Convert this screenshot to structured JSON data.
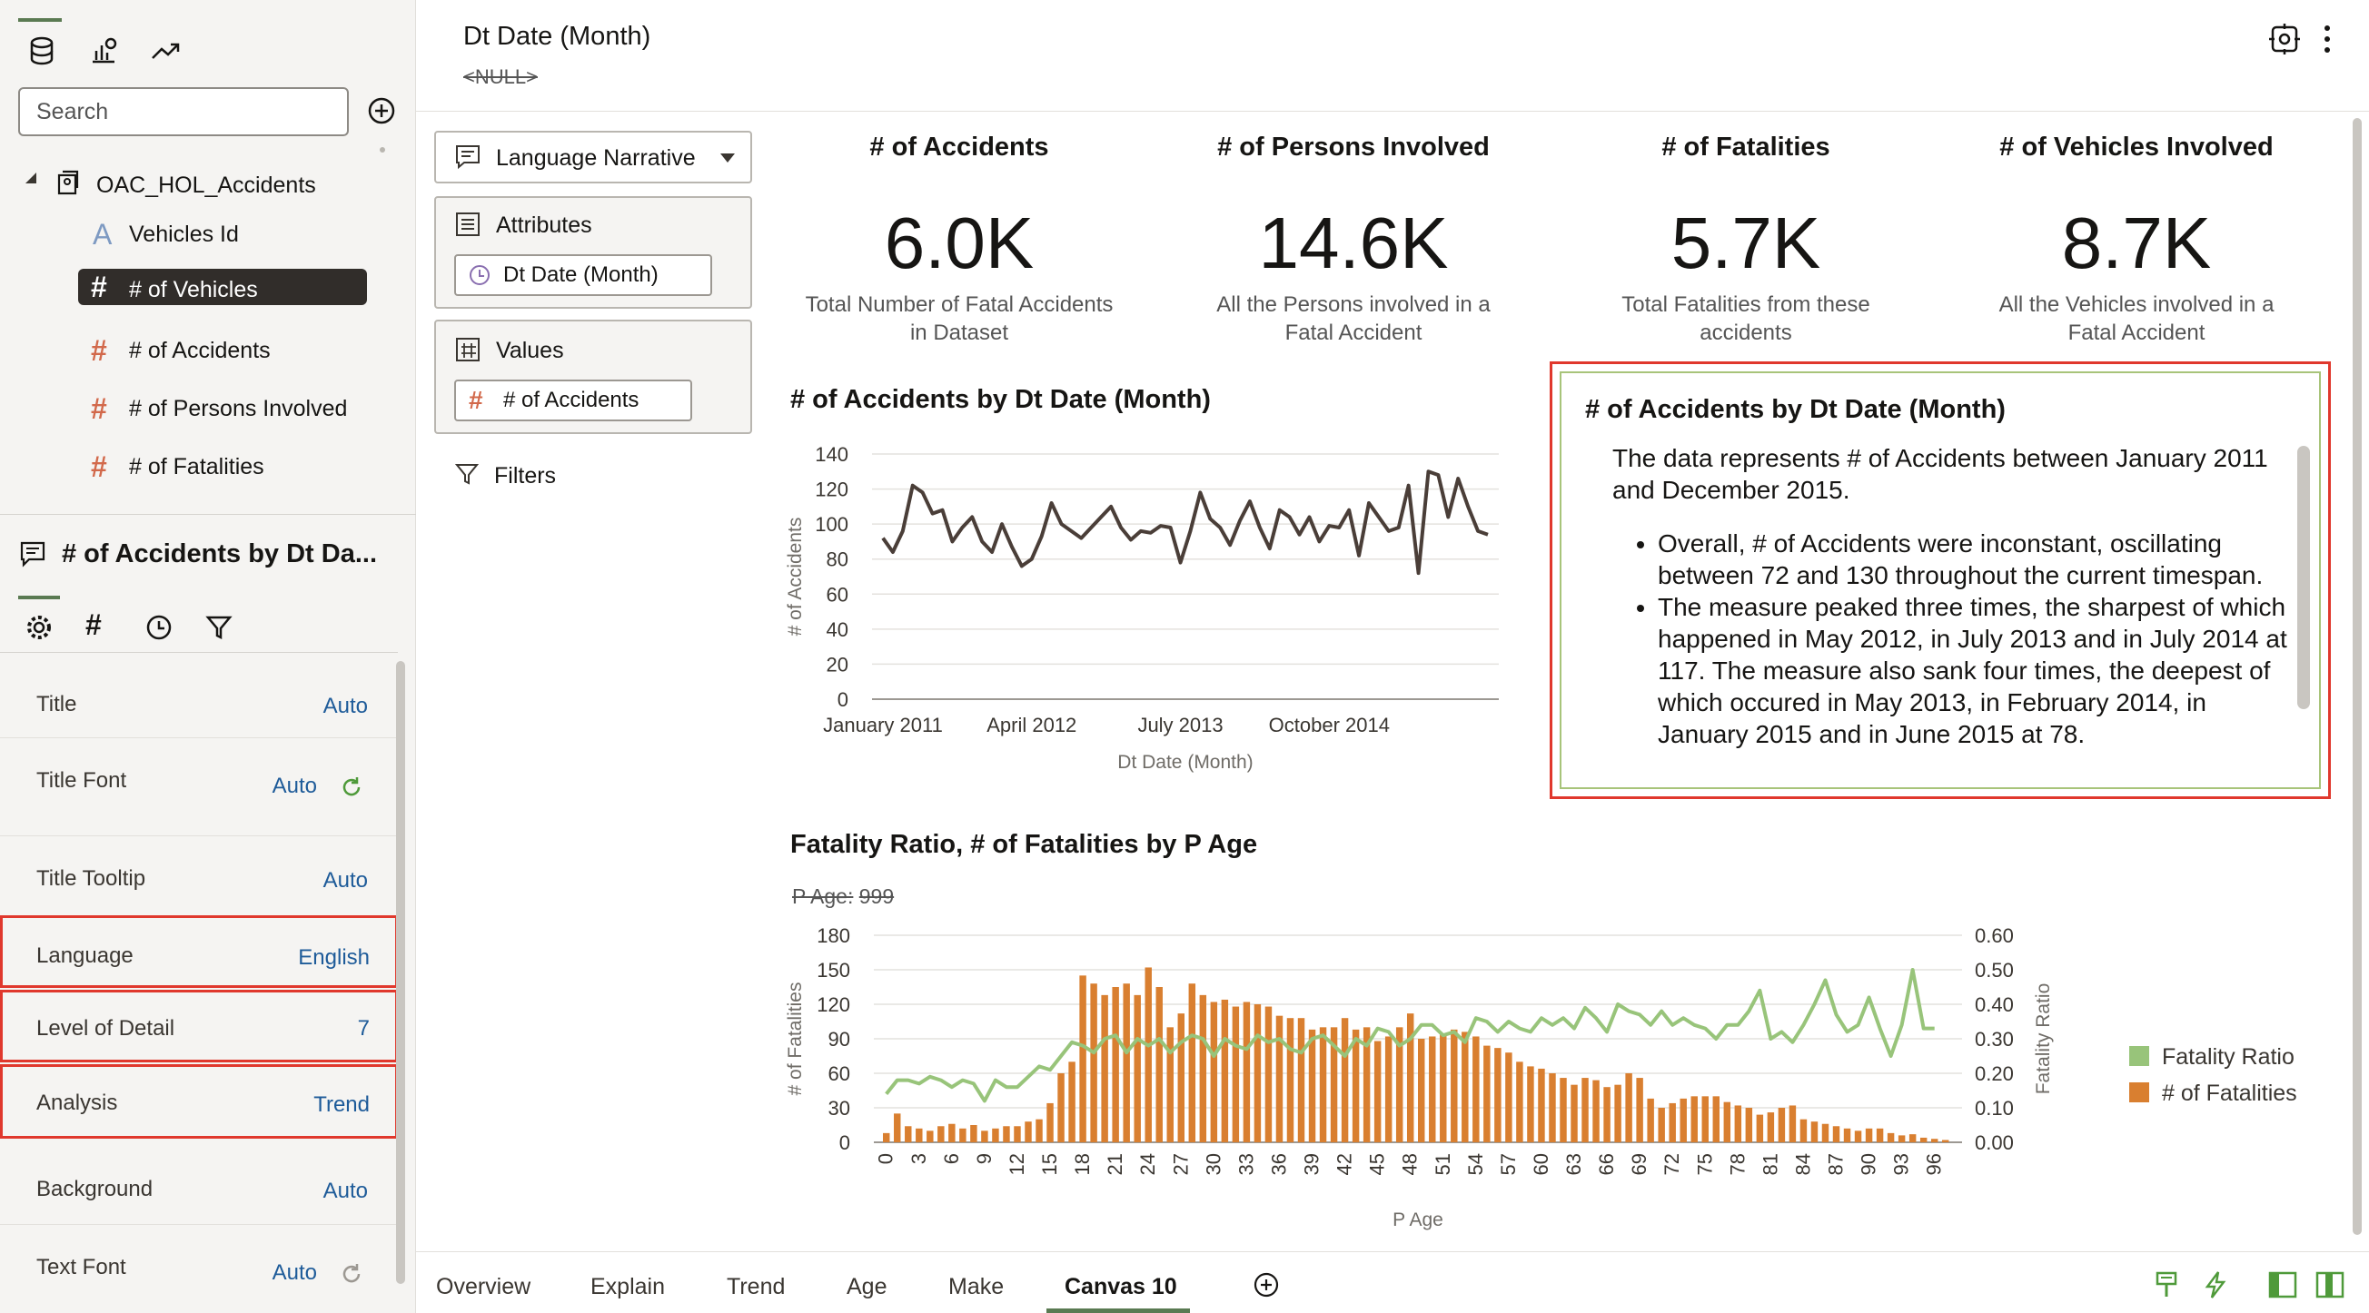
{
  "toolbar": {
    "icons": [
      "database-icon",
      "visualize-icon",
      "analytics-icon"
    ],
    "search_placeholder": "Search",
    "add_icon": "plus-circle-icon"
  },
  "data_tree": {
    "dataset": "OAC_HOL_Accidents",
    "items": [
      {
        "label": "Vehicles Id",
        "type": "attribute",
        "selected": false
      },
      {
        "label": "# of Vehicles",
        "type": "measure",
        "selected": true
      },
      {
        "label": "# of Accidents",
        "type": "measure",
        "selected": false
      },
      {
        "label": "# of Persons Involved",
        "type": "measure",
        "selected": false
      },
      {
        "label": "# of Fatalities",
        "type": "measure",
        "selected": false
      }
    ]
  },
  "properties": {
    "viz_name": "# of Accidents by Dt Da...",
    "tabs": [
      "gear-icon",
      "hash-icon",
      "clock-icon",
      "filter-icon"
    ],
    "rows": [
      {
        "label": "Title",
        "value": "Auto"
      },
      {
        "label": "Title Font",
        "value": "Auto"
      },
      {
        "label": "Title Tooltip",
        "value": "Auto"
      },
      {
        "label": "Language",
        "value": "English"
      },
      {
        "label": "Level of Detail",
        "value": "7"
      },
      {
        "label": "Analysis",
        "value": "Trend"
      },
      {
        "label": "Background",
        "value": "Auto"
      },
      {
        "label": "Text Font",
        "value": "Auto"
      }
    ]
  },
  "header": {
    "title": "Dt Date (Month)",
    "null_label": "<NULL>"
  },
  "grammar": {
    "viz_type": "Language Narrative",
    "attributes_label": "Attributes",
    "attribute_pill": "Dt Date (Month)",
    "values_label": "Values",
    "value_pill": "# of Accidents",
    "filters_label": "Filters"
  },
  "tiles": [
    {
      "title": "# of Accidents",
      "value": "6.0K",
      "sub1": "Total Number of Fatal Accidents",
      "sub2": "in Dataset"
    },
    {
      "title": "# of Persons Involved",
      "value": "14.6K",
      "sub1": "All the Persons involved in a",
      "sub2": "Fatal Accident"
    },
    {
      "title": "# of Fatalities",
      "value": "5.7K",
      "sub1": "Total Fatalities from these",
      "sub2": "accidents"
    },
    {
      "title": "# of Vehicles Involved",
      "value": "8.7K",
      "sub1": "All the Vehicles involved in a",
      "sub2": "Fatal Accident"
    }
  ],
  "line_chart": {
    "title": "# of Accidents by Dt Date (Month)",
    "xlabel": "Dt Date (Month)",
    "ylabel": "# of Accidents",
    "yticks": [
      "0",
      "20",
      "40",
      "60",
      "80",
      "100",
      "120",
      "140"
    ],
    "xticks": [
      "January 2011",
      "April 2012",
      "July 2013",
      "October 2014"
    ]
  },
  "narrative": {
    "title": "# of Accidents by Dt Date (Month)",
    "intro": "The data represents # of Accidents between January 2011 and December 2015.",
    "bullets": [
      "Overall, # of Accidents were inconstant, oscillating between 72 and 130 throughout the current timespan.",
      "The measure peaked three times, the sharpest of which happened in May 2012, in July 2013 and in July 2014 at 117. The measure also sank four times, the deepest of which occured in May 2013, in February 2014, in January 2015 and in June 2015 at 78."
    ]
  },
  "combo_chart": {
    "title": "Fatality Ratio, # of Fatalities by P Age",
    "filter_label": "P Age:",
    "filter_value": "999",
    "xlabel": "P Age",
    "ylabel_left": "# of Fatalities",
    "ylabel_right": "Fatality Ratio",
    "yticks_left": [
      "0",
      "30",
      "60",
      "90",
      "120",
      "150",
      "180"
    ],
    "yticks_right": [
      "0.00",
      "0.10",
      "0.20",
      "0.30",
      "0.40",
      "0.50",
      "0.60"
    ],
    "legend": [
      "Fatality Ratio",
      "# of Fatalities"
    ]
  },
  "colors": {
    "line": "#4a3e38",
    "bar": "#d97f30",
    "ratio": "#98c47a",
    "highlight": "#e0382d",
    "link": "#1e5b99"
  },
  "chart_data": [
    {
      "type": "line",
      "title": "# of Accidents by Dt Date (Month)",
      "xlabel": "Dt Date (Month)",
      "ylabel": "# of Accidents",
      "ylim": [
        0,
        140
      ],
      "x_start": "January 2011",
      "x_end": "December 2015",
      "series": [
        {
          "name": "# of Accidents",
          "values": [
            92,
            84,
            96,
            122,
            118,
            106,
            108,
            90,
            98,
            104,
            90,
            84,
            100,
            87,
            76,
            80,
            93,
            112,
            100,
            96,
            92,
            98,
            104,
            110,
            98,
            91,
            96,
            95,
            99,
            98,
            78,
            96,
            118,
            103,
            98,
            88,
            102,
            113,
            98,
            86,
            108,
            104,
            94,
            104,
            90,
            99,
            98,
            108,
            82,
            112,
            104,
            96,
            98,
            122,
            72,
            130,
            128,
            104,
            126,
            110,
            96,
            94
          ]
        }
      ]
    },
    {
      "type": "bar",
      "title": "Fatality Ratio, # of Fatalities by P Age",
      "xlabel": "P Age",
      "ylabel": "# of Fatalities",
      "ylim": [
        0,
        180
      ],
      "x": [
        0,
        1,
        2,
        3,
        4,
        5,
        6,
        7,
        8,
        9,
        10,
        11,
        12,
        13,
        14,
        15,
        16,
        17,
        18,
        19,
        20,
        21,
        22,
        23,
        24,
        25,
        26,
        27,
        28,
        29,
        30,
        31,
        32,
        33,
        34,
        35,
        36,
        37,
        38,
        39,
        40,
        41,
        42,
        43,
        44,
        45,
        46,
        47,
        48,
        49,
        50,
        51,
        52,
        53,
        54,
        55,
        56,
        57,
        58,
        59,
        60,
        61,
        62,
        63,
        64,
        65,
        66,
        67,
        68,
        69,
        70,
        71,
        72,
        73,
        74,
        75,
        76,
        77,
        78,
        79,
        80,
        81,
        82,
        83,
        84,
        85,
        86,
        87,
        88,
        89,
        90,
        91,
        92,
        93,
        94,
        95,
        96,
        97
      ],
      "series": [
        {
          "name": "# of Fatalities",
          "values": [
            8,
            25,
            14,
            12,
            10,
            14,
            16,
            12,
            15,
            10,
            12,
            14,
            14,
            18,
            20,
            34,
            60,
            70,
            145,
            138,
            128,
            135,
            138,
            128,
            152,
            135,
            100,
            112,
            138,
            128,
            122,
            124,
            118,
            122,
            120,
            118,
            110,
            108,
            108,
            98,
            100,
            100,
            108,
            98,
            100,
            88,
            92,
            100,
            112,
            90,
            92,
            94,
            98,
            96,
            92,
            84,
            82,
            78,
            70,
            66,
            64,
            60,
            56,
            50,
            56,
            54,
            48,
            50,
            60,
            56,
            38,
            30,
            34,
            38,
            40,
            40,
            40,
            35,
            32,
            30,
            24,
            26,
            30,
            32,
            20,
            18,
            16,
            14,
            12,
            10,
            12,
            12,
            8,
            6,
            7,
            4,
            3,
            2
          ]
        },
        {
          "name": "Fatality Ratio",
          "axis": "right",
          "values": [
            0.14,
            0.18,
            0.18,
            0.17,
            0.19,
            0.18,
            0.16,
            0.18,
            0.17,
            0.12,
            0.18,
            0.16,
            0.16,
            0.19,
            0.22,
            0.21,
            0.25,
            0.29,
            0.28,
            0.26,
            0.3,
            0.31,
            0.26,
            0.3,
            0.28,
            0.3,
            0.26,
            0.29,
            0.31,
            0.3,
            0.25,
            0.3,
            0.28,
            0.27,
            0.31,
            0.29,
            0.3,
            0.27,
            0.26,
            0.3,
            0.31,
            0.28,
            0.25,
            0.3,
            0.28,
            0.33,
            0.32,
            0.28,
            0.3,
            0.34,
            0.34,
            0.31,
            0.32,
            0.29,
            0.36,
            0.35,
            0.32,
            0.35,
            0.33,
            0.32,
            0.36,
            0.34,
            0.36,
            0.33,
            0.39,
            0.36,
            0.32,
            0.4,
            0.38,
            0.37,
            0.34,
            0.38,
            0.34,
            0.36,
            0.34,
            0.33,
            0.3,
            0.34,
            0.34,
            0.38,
            0.44,
            0.3,
            0.32,
            0.29,
            0.34,
            0.4,
            0.47,
            0.37,
            0.32,
            0.34,
            0.42,
            0.33,
            0.25,
            0.34,
            0.5,
            0.33,
            0.33
          ]
        }
      ]
    }
  ],
  "tabs": {
    "items": [
      "Overview",
      "Explain",
      "Trend",
      "Age",
      "Make",
      "Canvas 10"
    ],
    "active": "Canvas 10"
  }
}
